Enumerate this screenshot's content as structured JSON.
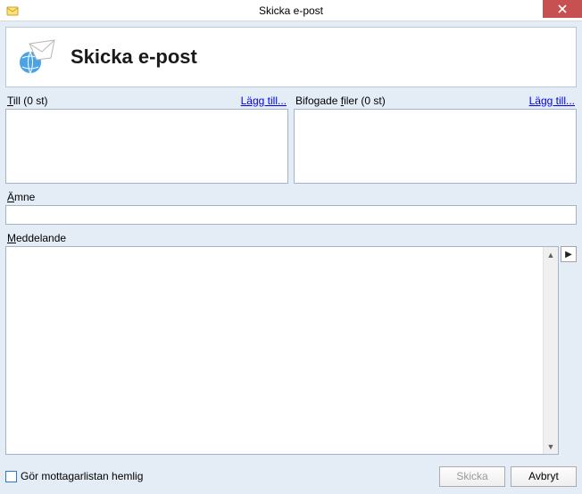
{
  "window": {
    "title": "Skicka e-post",
    "close_tooltip": "Stäng"
  },
  "header": {
    "title": "Skicka e-post"
  },
  "recipients": {
    "label_prefix": "T",
    "label_rest": "ill (0 st)",
    "add_link": "Lägg till..."
  },
  "attachments": {
    "label_pre": "Bifogade ",
    "label_u": "f",
    "label_post": "iler (0 st)",
    "add_link": "Lägg till..."
  },
  "subject": {
    "label_u": "Ä",
    "label_rest": "mne",
    "value": ""
  },
  "message": {
    "label_u": "M",
    "label_rest": "eddelande",
    "value": ""
  },
  "footer": {
    "hide_recipients_label": "Gör mottagarlistan hemlig",
    "send_label": "Skicka",
    "cancel_label": "Avbryt"
  }
}
